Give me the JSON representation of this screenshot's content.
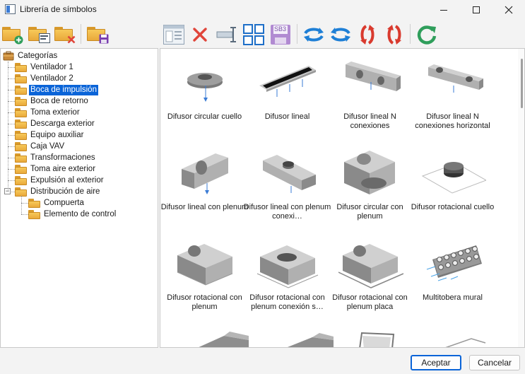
{
  "window": {
    "title": "Librería de símbolos"
  },
  "tree": {
    "root": "Categorías",
    "items": [
      {
        "label": "Ventilador 1",
        "level": 1
      },
      {
        "label": "Ventilador 2",
        "level": 1
      },
      {
        "label": "Boca de impulsión",
        "level": 1,
        "selected": true
      },
      {
        "label": "Boca de retorno",
        "level": 1
      },
      {
        "label": "Toma exterior",
        "level": 1
      },
      {
        "label": "Descarga exterior",
        "level": 1
      },
      {
        "label": "Equipo auxiliar",
        "level": 1
      },
      {
        "label": "Caja VAV",
        "level": 1
      },
      {
        "label": "Transformaciones",
        "level": 1
      },
      {
        "label": "Toma aire exterior",
        "level": 1
      },
      {
        "label": "Expulsión al exterior",
        "level": 1
      },
      {
        "label": "Distribución de aire",
        "level": 1,
        "expanded": true
      },
      {
        "label": "Compuerta",
        "level": 2
      },
      {
        "label": "Elemento de control",
        "level": 2
      }
    ]
  },
  "symbols": [
    {
      "label": "Difusor circular cuello"
    },
    {
      "label": "Difusor lineal"
    },
    {
      "label": "Difusor lineal N conexiones"
    },
    {
      "label": "Difusor lineal N conexiones horizontal"
    },
    {
      "label": "Difusor lineal con plenum"
    },
    {
      "label": "Difusor lineal con plenum conexi…"
    },
    {
      "label": "Difusor circular con plenum"
    },
    {
      "label": "Difusor rotacional cuello"
    },
    {
      "label": "Difusor rotacional con plenum"
    },
    {
      "label": "Difusor rotacional con plenum conexión s…"
    },
    {
      "label": "Difusor rotacional con plenum placa"
    },
    {
      "label": "Multitobera mural"
    }
  ],
  "toolbar": {
    "icons": [
      "folder-add-icon",
      "folder-edit-icon",
      "folder-delete-icon",
      "folder-save-icon",
      "symbol-properties-icon",
      "delete-icon",
      "insert-icon",
      "grid-view-icon",
      "sb3-icon",
      "rotate-horizontal-icon",
      "mirror-horizontal-icon",
      "rotate-vertical-icon",
      "mirror-vertical-icon",
      "refresh-icon"
    ],
    "sb3_label": "SB3"
  },
  "buttons": {
    "accept": "Aceptar",
    "cancel": "Cancelar"
  },
  "colors": {
    "accent": "#0a64d8",
    "folder": "#f0b94a",
    "delete": "#e0453a",
    "rotate_blue": "#1e7fd6",
    "rotate_red": "#d93a2e",
    "refresh_green": "#2f9e5b"
  }
}
